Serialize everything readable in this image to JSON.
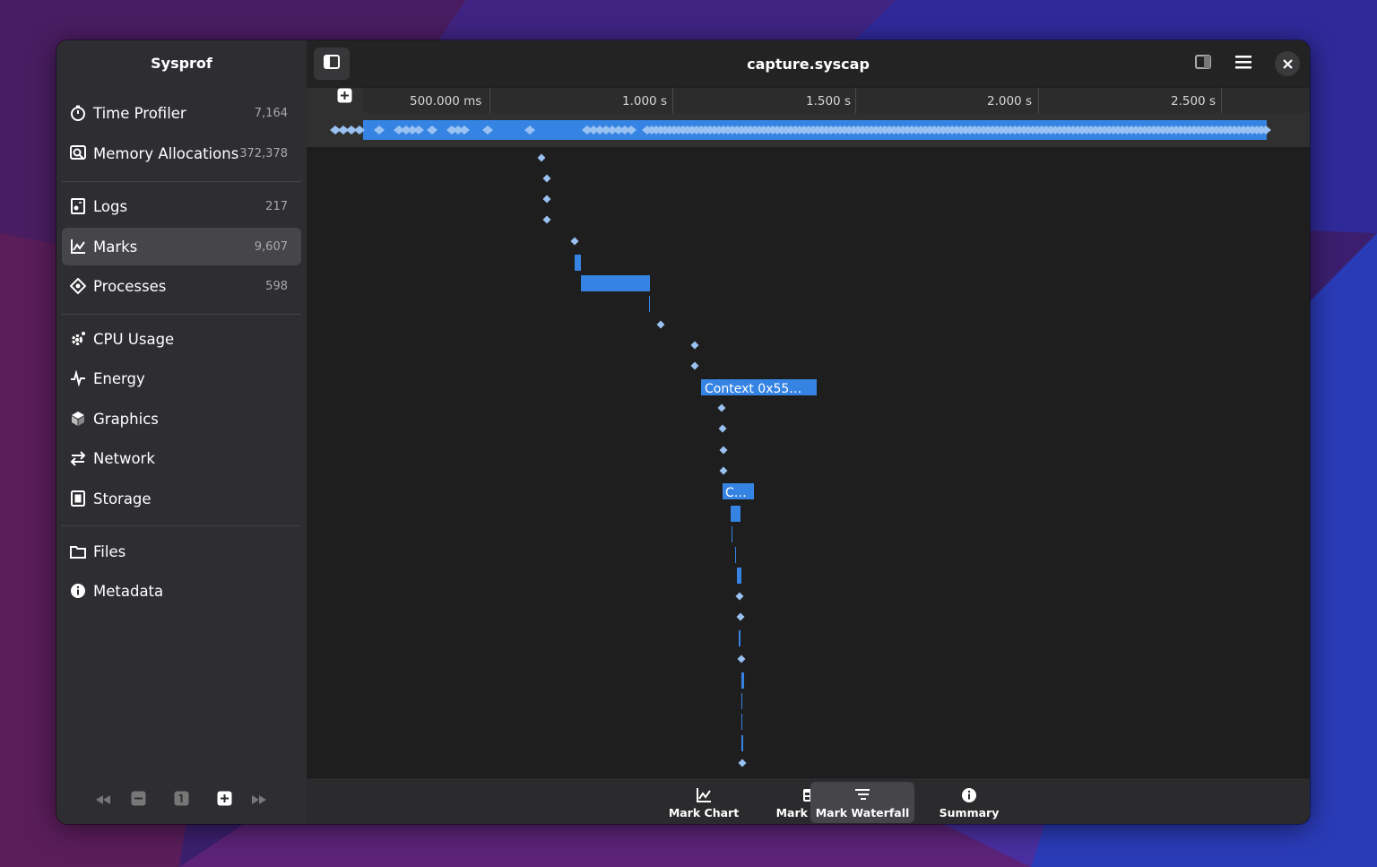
{
  "app": {
    "sidebar_title": "Sysprof",
    "window_title": "capture.syscap"
  },
  "sidebar": {
    "items": [
      {
        "label": "Time Profiler",
        "count": "7,164",
        "icon": "timer-icon"
      },
      {
        "label": "Memory Allocations",
        "count": "372,378",
        "icon": "memory-search-icon"
      },
      {
        "label": "Logs",
        "count": "217",
        "icon": "logs-icon"
      },
      {
        "label": "Marks",
        "count": "9,607",
        "icon": "marks-chart-icon",
        "selected": true
      },
      {
        "label": "Processes",
        "count": "598",
        "icon": "processes-icon"
      },
      {
        "label": "CPU Usage",
        "count": "",
        "icon": "cpu-gear-icon"
      },
      {
        "label": "Energy",
        "count": "",
        "icon": "energy-pulse-icon"
      },
      {
        "label": "Graphics",
        "count": "",
        "icon": "graphics-cube-icon"
      },
      {
        "label": "Network",
        "count": "",
        "icon": "network-arrows-icon"
      },
      {
        "label": "Storage",
        "count": "",
        "icon": "storage-icon"
      },
      {
        "label": "Files",
        "count": "",
        "icon": "folder-icon"
      },
      {
        "label": "Metadata",
        "count": "",
        "icon": "info-icon"
      }
    ]
  },
  "ruler": {
    "ticks": [
      "500.000 ms",
      "1.000 s",
      "1.500 s",
      "2.000 s",
      "2.500 s"
    ]
  },
  "waterfall": {
    "labels": [
      "Context 0x55…",
      "C…"
    ]
  },
  "views": [
    {
      "label": "Mark Chart",
      "icon": "mark-chart-icon"
    },
    {
      "label": "Mark Table",
      "icon": "mark-table-icon"
    },
    {
      "label": "Mark Waterfall",
      "icon": "mark-waterfall-icon",
      "selected": true
    },
    {
      "label": "Summary",
      "icon": "summary-info-icon"
    }
  ],
  "colors": {
    "accent": "#3584e4",
    "marker": "#99c1f1",
    "selected_row": "#45454a"
  }
}
